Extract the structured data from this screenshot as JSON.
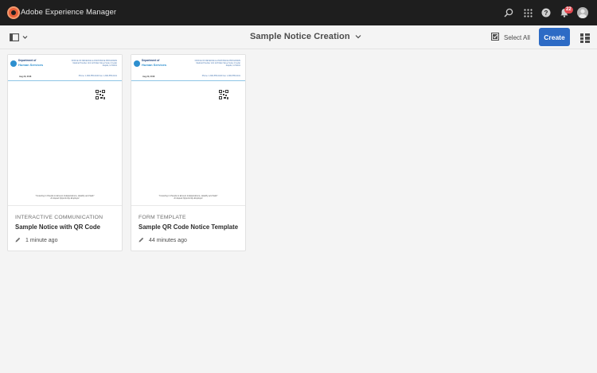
{
  "app": {
    "title": "Adobe Experience Manager"
  },
  "topbar": {
    "icons": [
      "search-icon",
      "apps-grid-icon",
      "help-icon",
      "notifications-bell-icon",
      "user-avatar"
    ],
    "notification_count": "22"
  },
  "actionbar": {
    "heading": "Sample Notice Creation",
    "select_all": "Select All",
    "create": "Create"
  },
  "colors": {
    "accent": "#2d6bc5",
    "topbar": "#1e1e1e",
    "badge": "#e34850"
  },
  "cards": [
    {
      "type": "INTERACTIVE COMMUNICATION",
      "title": "Sample Notice with QR Code",
      "modified": "1 minute ago",
      "thumb": {
        "dept_line1": "Department of",
        "dept_line2": "Human Services",
        "address": "OFFICE OF REVENUE & ASSISTANCE PROGRAMS Medical Provider Unit 123 Main Street Suite 4 Cedar Rapids, IA 52401",
        "date": "Aug 29, 2018",
        "phone": "Phone: 1-800-555-0100 Fax: 1-800-555-0101",
        "footer_line1": "\"Investing in People to Ensure Independence, Healthy and Safe\"",
        "footer_line2": "An Equal Opportunity Employer"
      }
    },
    {
      "type": "FORM TEMPLATE",
      "title": "Sample QR Code Notice Template",
      "modified": "44 minutes ago",
      "thumb": {
        "dept_line1": "Department of",
        "dept_line2": "Human Services",
        "address": "OFFICE OF REVENUE & ASSISTANCE PROGRAMS Medical Provider Unit 123 Main Street Suite 4 Cedar Rapids, IA 52401",
        "date": "Aug 29, 2018",
        "phone": "Phone: 1-800-555-0100 Fax: 1-800-555-0101",
        "footer_line1": "\"Investing in People to Ensure Independence, Healthy and Safe\"",
        "footer_line2": "An Equal Opportunity Employer"
      }
    }
  ]
}
